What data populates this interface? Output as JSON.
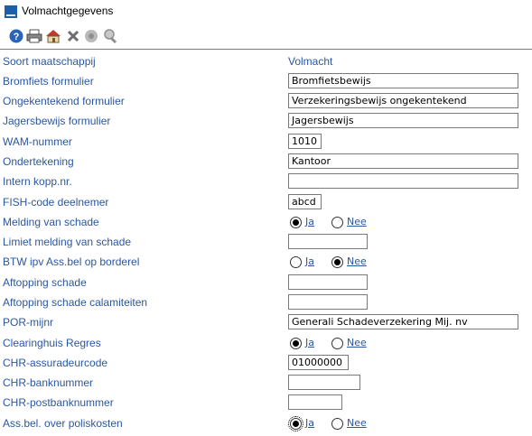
{
  "window": {
    "title": "Volmachtgegevens"
  },
  "toolbar": {
    "buttons": [
      {
        "name": "help-button",
        "icon": "help-icon"
      },
      {
        "name": "print-button",
        "icon": "printer-icon"
      },
      {
        "name": "home-button",
        "icon": "home-icon"
      },
      {
        "name": "delete-button",
        "icon": "close-icon"
      },
      {
        "name": "info-button",
        "icon": "info-icon"
      },
      {
        "name": "search-button",
        "icon": "magnifier-icon"
      }
    ]
  },
  "form": {
    "header_label": "Soort maatschappij",
    "header_value": "Volmacht",
    "rows": [
      {
        "label": "Bromfiets formulier",
        "type": "text",
        "value": "Bromfietsbewijs"
      },
      {
        "label": "Ongekentekend formulier",
        "type": "text",
        "value": "Verzekeringsbewijs ongekentekend"
      },
      {
        "label": "Jagersbewijs formulier",
        "type": "text",
        "value": "Jagersbewijs"
      },
      {
        "label": "WAM-nummer",
        "type": "text",
        "value": "1010"
      },
      {
        "label": "Ondertekening",
        "type": "text",
        "value": "Kantoor"
      },
      {
        "label": "Intern kopp.nr.",
        "type": "text",
        "value": ""
      },
      {
        "label": "FISH-code deelnemer",
        "type": "text",
        "value": "abcd"
      },
      {
        "label": "Melding van schade",
        "type": "radio",
        "selected": "Ja"
      },
      {
        "label": "Limiet melding van schade",
        "type": "text",
        "value": ""
      },
      {
        "label": "BTW ipv Ass.bel op borderel",
        "type": "radio",
        "selected": "Nee"
      },
      {
        "label": "Aftopping schade",
        "type": "text",
        "value": ""
      },
      {
        "label": "Aftopping schade calamiteiten",
        "type": "text",
        "value": ""
      },
      {
        "label": "POR-mijnr",
        "type": "text",
        "value": "Generali Schadeverzekering Mij. nv"
      },
      {
        "label": "Clearinghuis Regres",
        "type": "radio",
        "selected": "Ja"
      },
      {
        "label": "CHR-assuradeurcode",
        "type": "text",
        "value": "01000000"
      },
      {
        "label": "CHR-banknummer",
        "type": "text",
        "value": ""
      },
      {
        "label": "CHR-postbanknummer",
        "type": "text",
        "value": ""
      },
      {
        "label": "Ass.bel. over poliskosten",
        "type": "radio",
        "selected": "Ja"
      }
    ],
    "radio_yes": "Ja",
    "radio_no": "Nee"
  },
  "colors": {
    "label": "#2b57a0",
    "icon_help": "#2a63b8",
    "icon_delete": "#6d6d6d"
  }
}
